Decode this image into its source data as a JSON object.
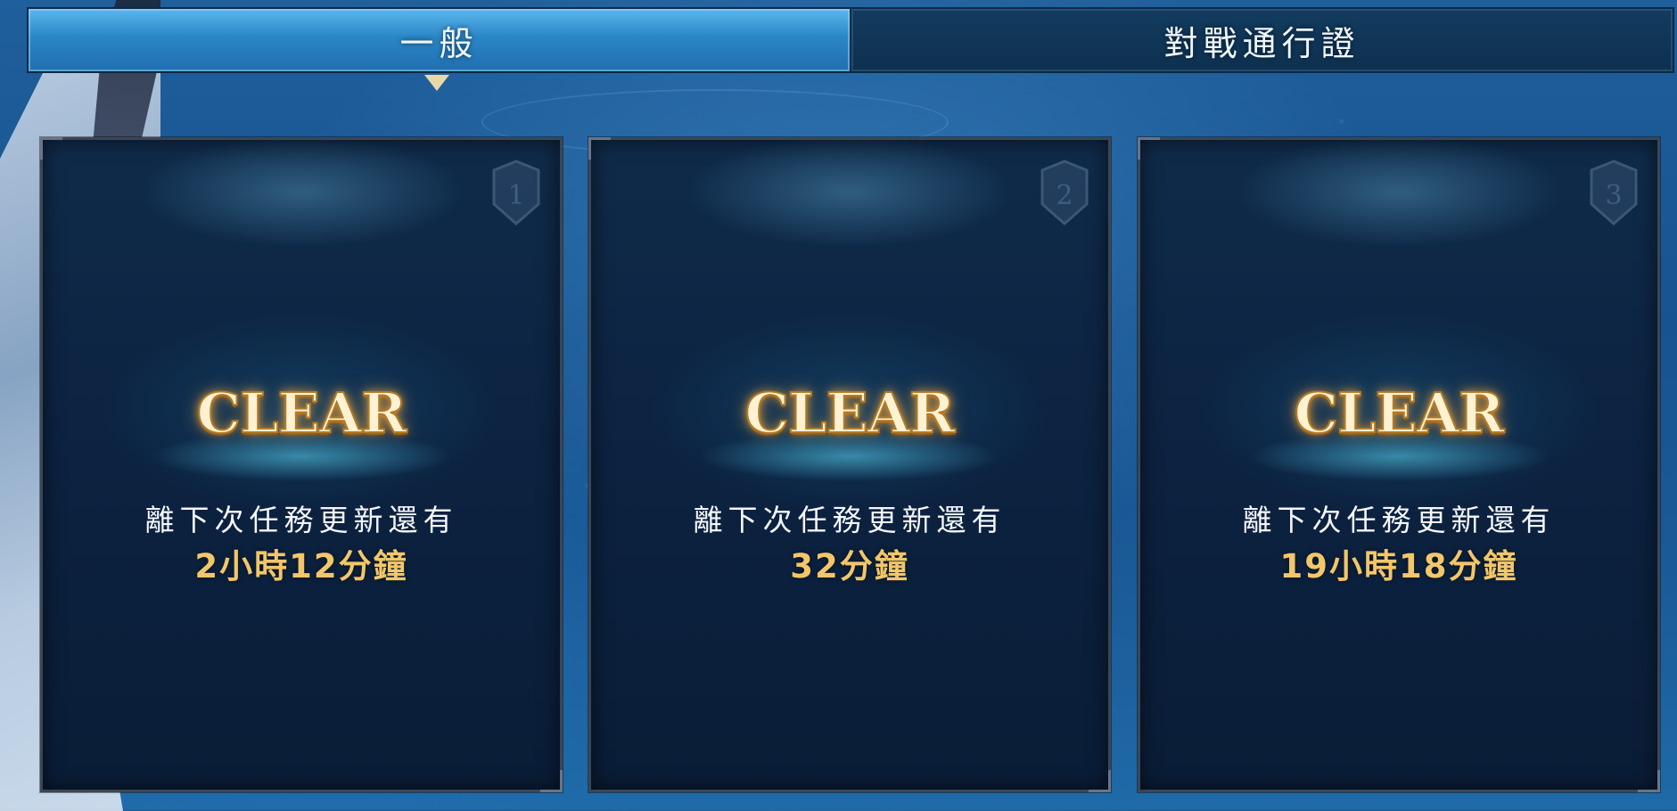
{
  "tabs": [
    {
      "label": "一般",
      "active": true
    },
    {
      "label": "對戰通行證",
      "active": false
    }
  ],
  "cards": [
    {
      "rank": "1",
      "status": "CLEAR",
      "refresh_label": "離下次任務更新還有",
      "refresh_time": "2小時12分鐘"
    },
    {
      "rank": "2",
      "status": "CLEAR",
      "refresh_label": "離下次任務更新還有",
      "refresh_time": "32分鐘"
    },
    {
      "rank": "3",
      "status": "CLEAR",
      "refresh_label": "離下次任務更新還有",
      "refresh_time": "19小時18分鐘"
    }
  ],
  "colors": {
    "accent_gold": "#f2c66a",
    "tab_active": "#2b86c6",
    "card_bg": "#0c2240"
  },
  "icons": {
    "rank_badge": "shield-number-badge-icon"
  }
}
